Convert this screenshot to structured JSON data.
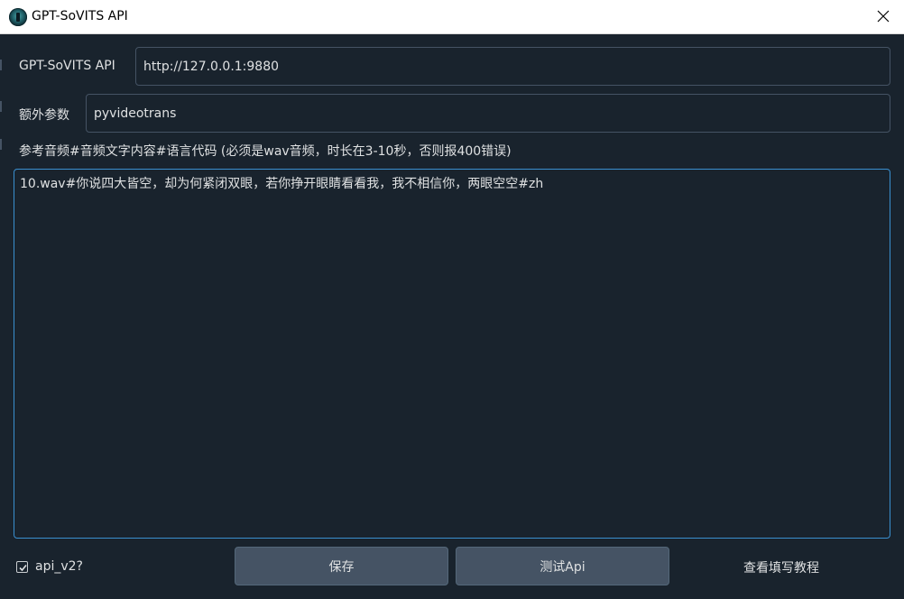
{
  "window": {
    "title": "GPT-SoVITS API",
    "icon": "app-logo-icon",
    "close_icon": "close-icon"
  },
  "form": {
    "api_label": "GPT-SoVITS API",
    "api_value": "http://127.0.0.1:9880",
    "extra_label": "额外参数",
    "extra_value": "pyvideotrans",
    "ref_label": "参考音频#音频文字内容#语言代码 (必须是wav音频，时长在3-10秒，否则报400错误)",
    "ref_value": "10.wav#你说四大皆空，却为何紧闭双眼，若你挣开眼睛看看我，我不相信你，两眼空空#zh"
  },
  "bottom": {
    "checkbox_label": "api_v2?",
    "checkbox_checked": true,
    "save_label": "保存",
    "test_label": "测试Api",
    "tutorial_label": "查看填写教程"
  },
  "colors": {
    "background": "#19232d",
    "field_border": "#455364",
    "focus_border": "#3a8fcf",
    "button_bg": "#455364",
    "text": "#dfe1e2"
  }
}
